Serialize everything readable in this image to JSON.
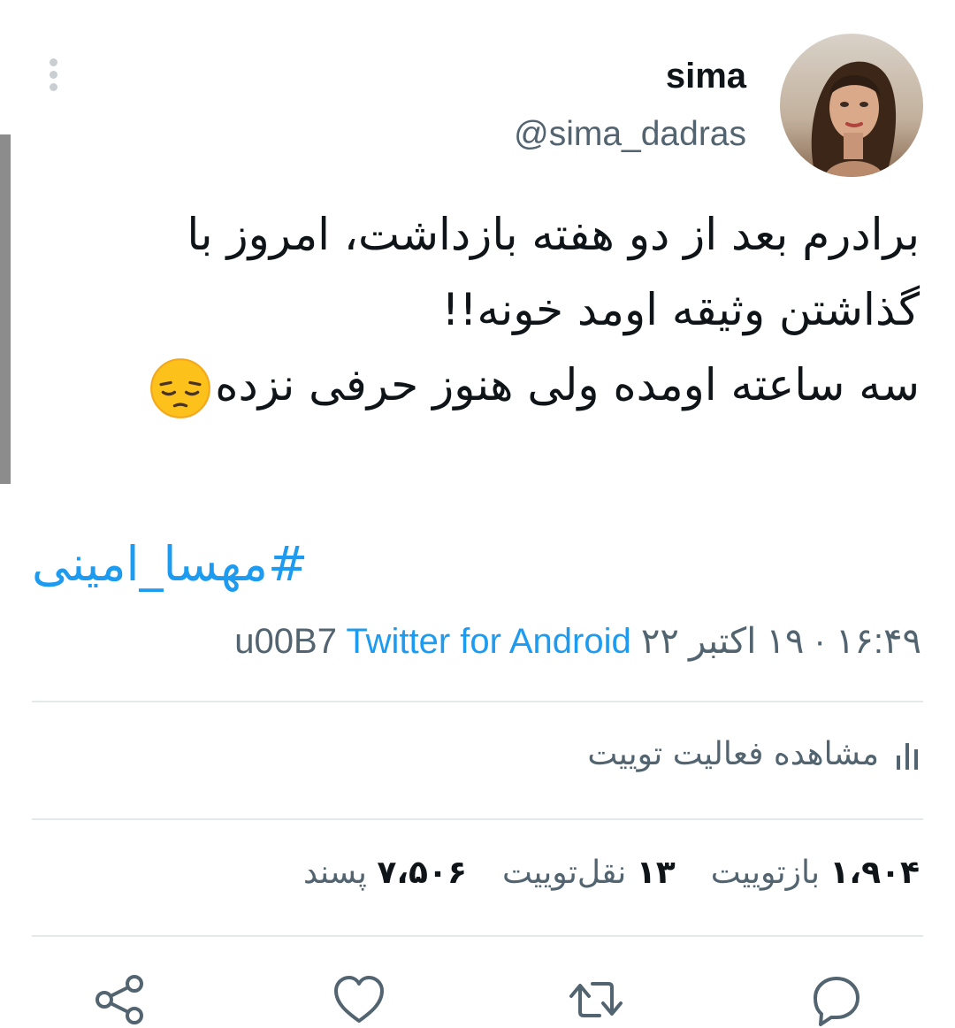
{
  "tweet": {
    "display_name": "sima",
    "handle": "@sima_dadras",
    "text_lines": [
      "برادرم بعد از دو هفته بازداشت، امروز با",
      "گذاشتن وثیقه اومد خونه!!",
      "سه ساعته اومده ولی هنوز حرفی نزده"
    ],
    "emoji": "pensive-face",
    "hashtag": "#مهسا_امینی",
    "time": "۱۶:۴۹ · ۱۹ اکتبر ۲۲",
    "separator": "u00B7",
    "source": "Twitter for Android"
  },
  "activity": {
    "label": "مشاهده فعالیت توییت",
    "icon": "analytics-icon"
  },
  "stats": {
    "retweets_count": "۱،۹۰۴",
    "retweets_label": "بازتوییت",
    "quotes_count": "۱۳",
    "quotes_label": "نقل‌توییت",
    "likes_count": "۷،۵۰۶",
    "likes_label": "پسند"
  },
  "actions": [
    "reply-icon",
    "retweet-icon",
    "like-icon",
    "share-icon"
  ],
  "colors": {
    "accent": "#1d9bf0",
    "secondary_text": "#536471",
    "primary_text": "#0f1419",
    "divider": "#e6e9eb"
  }
}
